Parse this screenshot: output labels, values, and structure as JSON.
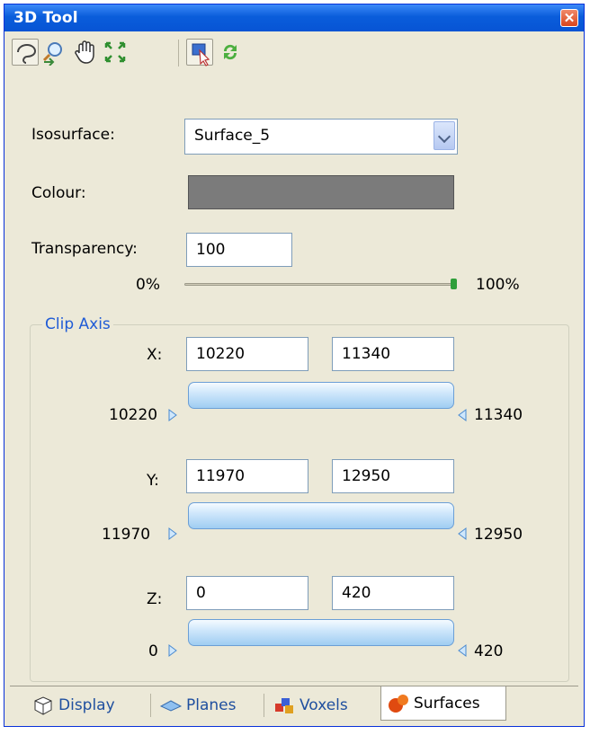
{
  "window": {
    "title": "3D Tool",
    "close_icon": "close-icon"
  },
  "toolbar": {
    "items": [
      {
        "name": "lasso-select-icon",
        "pressed": true
      },
      {
        "name": "zoom-icon",
        "pressed": false
      },
      {
        "name": "pan-hand-icon",
        "pressed": false
      },
      {
        "name": "fit-extent-icon",
        "pressed": false
      },
      {
        "name": "pick-icon",
        "pressed": true
      },
      {
        "name": "refresh-icon",
        "pressed": false
      }
    ]
  },
  "isosurface": {
    "label": "Isosurface:",
    "value": "Surface_5"
  },
  "colour": {
    "label": "Colour:",
    "swatch": "#7b7b7b"
  },
  "transparency": {
    "label": "Transparency:",
    "value": "100",
    "min_label": "0%",
    "max_label": "100%",
    "level_percent": 100
  },
  "clip": {
    "legend": "Clip Axis",
    "x": {
      "label": "X:",
      "min": "10220",
      "max": "11340",
      "range_min": "10220",
      "range_max": "11340"
    },
    "y": {
      "label": "Y:",
      "min": "11970",
      "max": "12950",
      "range_min": "11970",
      "range_max": "12950"
    },
    "z": {
      "label": "Z:",
      "min": "0",
      "max": "420",
      "range_min": "0",
      "range_max": "420"
    }
  },
  "tabs": [
    {
      "label": "Display",
      "icon": "cube-icon",
      "active": false
    },
    {
      "label": "Planes",
      "icon": "plane-icon",
      "active": false
    },
    {
      "label": "Voxels",
      "icon": "voxels-icon",
      "active": false
    },
    {
      "label": "Surfaces",
      "icon": "surfaces-icon",
      "active": true
    }
  ]
}
